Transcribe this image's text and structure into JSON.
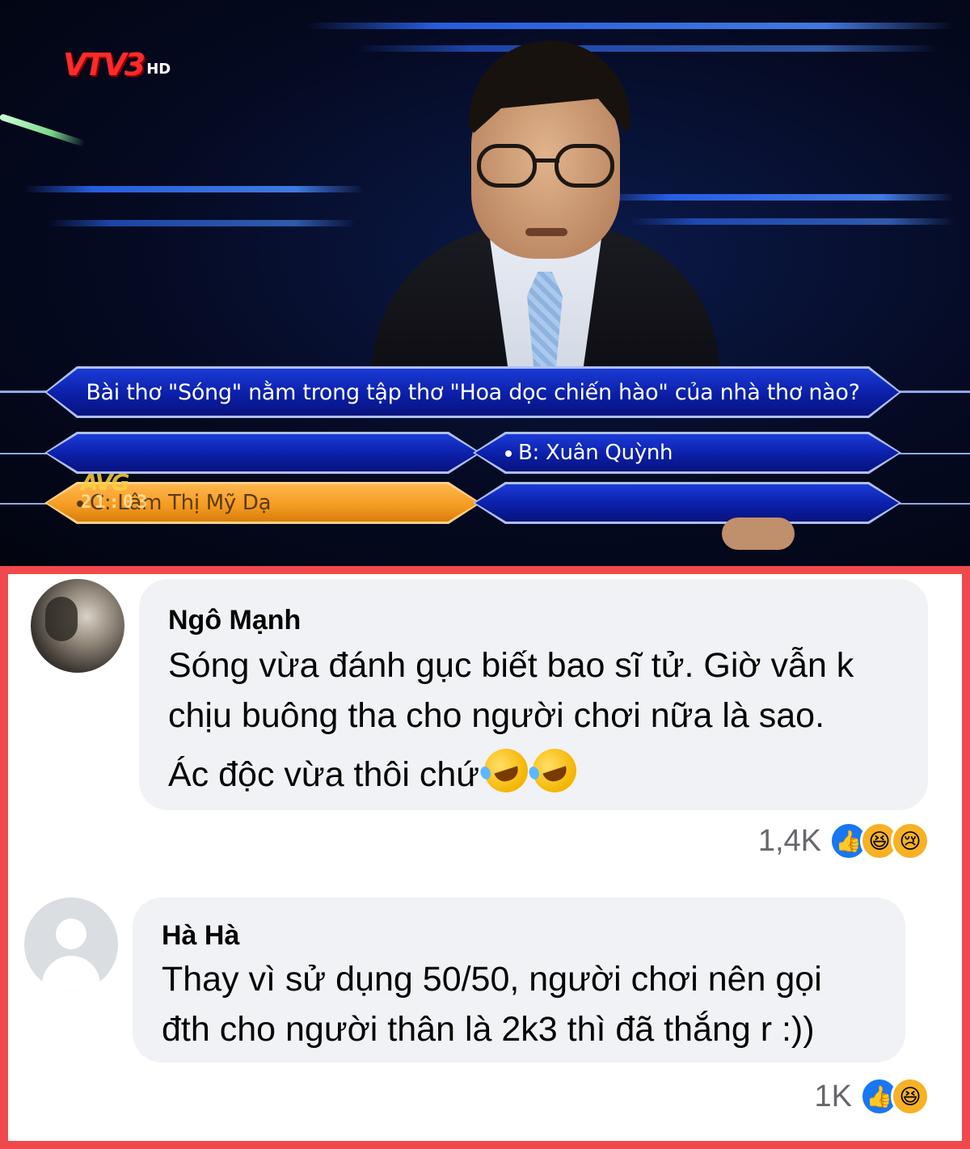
{
  "tv": {
    "channel_logo": "VTV3",
    "channel_hd": "HD",
    "question": "Bài thơ \"Sóng\" nằm trong tập thơ \"Hoa dọc chiến hào\" của nhà thơ nào?",
    "answer_a": "",
    "answer_b": "B: Xuân Quỳnh",
    "answer_c": "C: Lâm Thị Mỹ Dạ",
    "answer_d": "",
    "show_logo": "AVG",
    "clock": "21:03"
  },
  "comments": [
    {
      "name": "Ngô Mạnh",
      "lines": [
        "Sóng vừa đánh gục biết bao sĩ tử. Giờ vẫn k",
        "chịu buông tha cho người chơi nữa là sao.",
        "Ác độc vừa thôi chứ"
      ],
      "reaction_count": "1,4K",
      "reactions": [
        "like-icon",
        "haha-icon",
        "sad-icon"
      ]
    },
    {
      "name": "Hà Hà",
      "lines": [
        "Thay vì sử dụng 50/50, người chơi nên gọi",
        "đth cho người thân là 2k3 thì đã thắng r :))"
      ],
      "reaction_count": "1K",
      "reactions": [
        "like-icon",
        "haha-icon"
      ]
    }
  ],
  "colors": {
    "border": "#f0494d",
    "bubble": "#f0f2f5",
    "like": "#1877f2",
    "haha": "#f7b125",
    "question_box": "#0b1fa8",
    "selected_answer": "#f39a1f"
  }
}
